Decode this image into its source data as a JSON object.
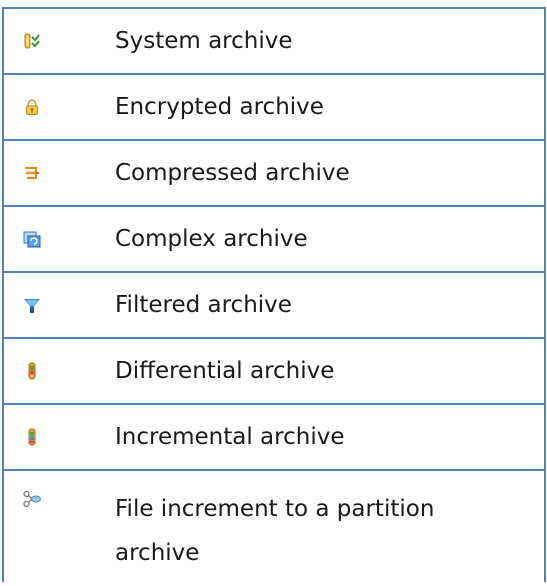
{
  "legend": {
    "rows": [
      {
        "icon": "system-archive-icon",
        "label": "System archive"
      },
      {
        "icon": "lock-icon",
        "label": "Encrypted archive"
      },
      {
        "icon": "clamp-icon",
        "label": "Compressed archive"
      },
      {
        "icon": "complex-archive-icon",
        "label": "Complex archive"
      },
      {
        "icon": "filter-funnel-icon",
        "label": "Filtered archive"
      },
      {
        "icon": "differential-archive-icon",
        "label": "Differential archive"
      },
      {
        "icon": "incremental-archive-icon",
        "label": "Incremental archive"
      },
      {
        "icon": "file-increment-icon",
        "label": "File increment to a partition archive"
      }
    ]
  }
}
